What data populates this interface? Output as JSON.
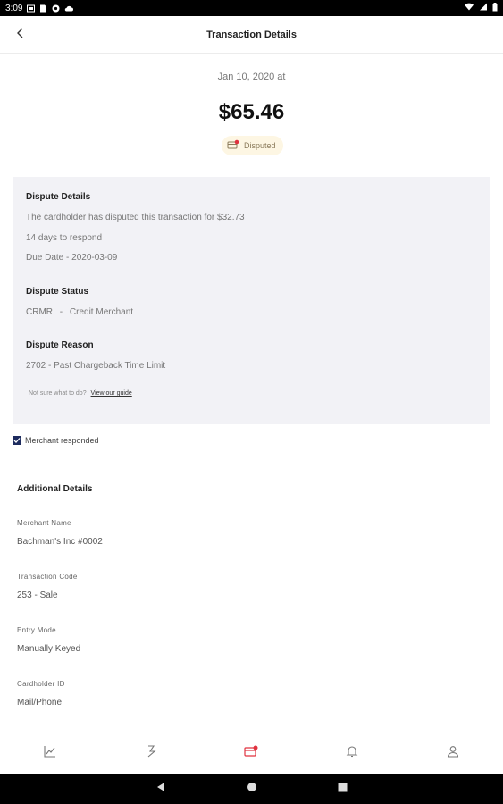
{
  "status_bar": {
    "time": "3:09"
  },
  "header": {
    "title": "Transaction Details"
  },
  "transaction": {
    "date": "Jan 10, 2020 at",
    "amount": "$65.46",
    "status": "Disputed"
  },
  "dispute": {
    "details_title": "Dispute Details",
    "details_text": "The cardholder has disputed this transaction for $32.73",
    "days_to_respond": "14 days to respond",
    "due_date": "Due Date - 2020-03-09",
    "status_title": "Dispute Status",
    "status_code": "CRMR",
    "status_sep": "-",
    "status_text": "Credit Merchant",
    "reason_title": "Dispute Reason",
    "reason_text": "2702 - Past Chargeback Time Limit",
    "help_text": "Not sure what to do?",
    "help_link": "View our guide"
  },
  "merchant_responded": {
    "label": "Merchant responded",
    "checked": true
  },
  "additional": {
    "title": "Additional Details",
    "fields": [
      {
        "label": "Merchant Name",
        "value": "Bachman's Inc #0002"
      },
      {
        "label": "Transaction Code",
        "value": "253 - Sale"
      },
      {
        "label": "Entry Mode",
        "value": "Manually Keyed"
      },
      {
        "label": "Cardholder ID",
        "value": "Mail/Phone"
      }
    ]
  },
  "bottom_nav": {
    "tabs": [
      {
        "icon": "chart-icon",
        "active": false
      },
      {
        "icon": "transactions-icon",
        "active": false
      },
      {
        "icon": "disputes-icon",
        "active": true
      },
      {
        "icon": "bell-icon",
        "active": false
      },
      {
        "icon": "profile-icon",
        "active": false
      }
    ]
  },
  "colors": {
    "accent": "#e0323f",
    "checkbox": "#1d2b5e",
    "dispute_bg": "#f2f2f6",
    "badge_bg": "#fdf6e3"
  }
}
